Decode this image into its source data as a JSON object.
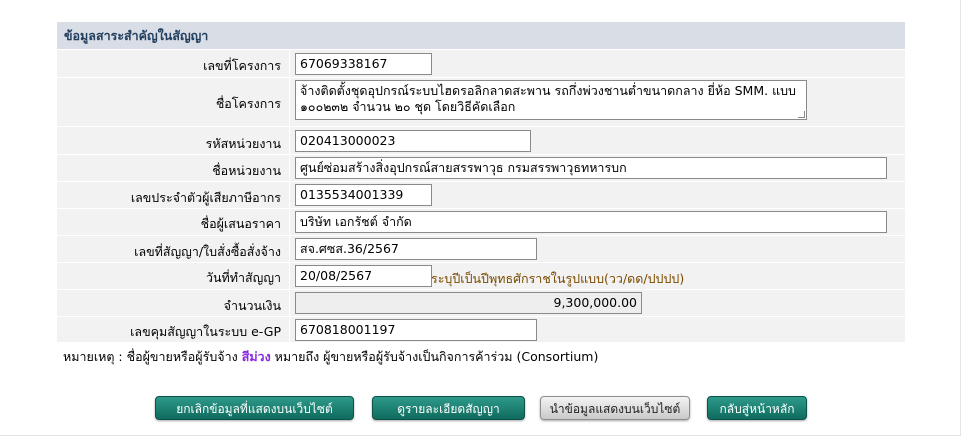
{
  "section": {
    "title": "ข้อมูลสาระสำคัญในสัญญา"
  },
  "fields": {
    "project_no": {
      "label": "เลขที่โครงการ",
      "value": "67069338167"
    },
    "project_name": {
      "label": "ชื่อโครงการ",
      "value": "จ้างติดตั้งชุดอุปกรณ์ระบบไฮดรอลิกลาดสะพาน รถกึ่งพ่วงชานต่ำขนาดกลาง ยี่ห้อ SMM. แบบ ๑๐๐๒๓๒ จำนวน ๒๐ ชุด โดยวิธีคัดเลือก"
    },
    "agency_code": {
      "label": "รหัสหน่วยงาน",
      "value": "020413000023"
    },
    "agency_name": {
      "label": "ชื่อหน่วยงาน",
      "value": "ศูนย์ซ่อมสร้างสิ่งอุปกรณ์สายสรรพาวุธ กรมสรรพาวุธทหารบก"
    },
    "tax_id": {
      "label": "เลขประจำตัวผู้เสียภาษีอากร",
      "value": "0135534001339"
    },
    "bidder_name": {
      "label": "ชื่อผู้เสนอราคา",
      "value": "บริษัท เอกรัชต์ จำกัด"
    },
    "contract_no": {
      "label": "เลขที่สัญญา/ใบสั่งซื้อสั่งจ้าง",
      "value": "สจ.ศซส.36/2567"
    },
    "contract_date": {
      "label": "วันที่ทำสัญญา",
      "value": "20/08/2567",
      "hint": "ระบุปีเป็นปีพุทธศักราชในรูปแบบ(วว/ดด/ปปปป)"
    },
    "amount": {
      "label": "จำนวนเงิน",
      "value": "9,300,000.00"
    },
    "egp_control_no": {
      "label": "เลขคุมสัญญาในระบบ e-GP",
      "value": "670818001197"
    }
  },
  "note": {
    "prefix": "หมายเหตุ : ชื่อผู้ขายหรือผู้รับจ้าง",
    "highlight": "สีม่วง",
    "suffix": "หมายถึง ผู้ขายหรือผู้รับจ้างเป็นกิจการค้าร่วม (Consortium)"
  },
  "buttons": {
    "cancel_display": "ยกเลิกข้อมูลที่แสดงบนเว็บไซต์",
    "view_contract": "ดูรายละเอียดสัญญา",
    "publish": "นำข้อมูลแสดงบนเว็บไซต์",
    "back_home": "กลับสู่หน้าหลัก"
  },
  "colors": {
    "header_bg": "#d8dde6",
    "panel_bg": "#f2f2f2",
    "teal_button": "#157a6c",
    "consortium_highlight": "#8a2be2"
  }
}
